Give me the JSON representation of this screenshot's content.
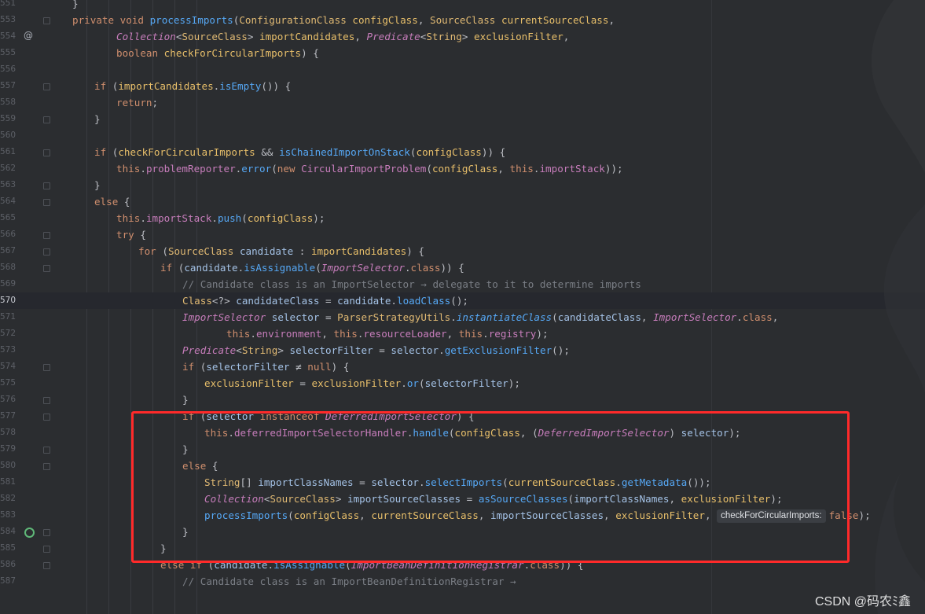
{
  "editor": {
    "lines": [
      {
        "n": "551",
        "html": "<span class='op'>}</span>",
        "indent": 1
      },
      {
        "n": "553",
        "html": "<span class='kw'>private void </span><span class='mth'>processImports</span><span class='op'>(</span><span class='cls'>ConfigurationClass</span><span class='op'> </span><span class='par'>configClass</span><span class='op'>, </span><span class='cls'>SourceClass</span><span class='op'> </span><span class='par'>currentSourceClass</span><span class='op'>,</span>",
        "indent": 1
      },
      {
        "n": "554",
        "html": "<span class='tyi'>Collection</span><span class='op'>&lt;</span><span class='cls'>SourceClass</span><span class='op'>&gt; </span><span class='par'>importCandidates</span><span class='op'>, </span><span class='tyi'>Predicate</span><span class='op'>&lt;</span><span class='cls'>String</span><span class='op'>&gt; </span><span class='par'>exclusionFilter</span><span class='op'>,</span>",
        "indent": 3
      },
      {
        "n": "555",
        "html": "<span class='kw'>boolean </span><span class='par'>checkForCircularImports</span><span class='op'>) {</span>",
        "indent": 3
      },
      {
        "n": "556",
        "html": "",
        "indent": 0
      },
      {
        "n": "557",
        "html": "<span class='kw'>if </span><span class='op'>(</span><span class='par'>importCandidates</span><span class='op'>.</span><span class='mth'>isEmpty</span><span class='op'>()) {</span>",
        "indent": 2
      },
      {
        "n": "558",
        "html": "<span class='kw'>return</span><span class='op'>;</span>",
        "indent": 3
      },
      {
        "n": "559",
        "html": "<span class='op'>}</span>",
        "indent": 2
      },
      {
        "n": "560",
        "html": "",
        "indent": 0
      },
      {
        "n": "561",
        "html": "<span class='kw'>if </span><span class='op'>(</span><span class='par'>checkForCircularImports</span><span class='op'> &amp;&amp; </span><span class='mth'>isChainedImportOnStack</span><span class='op'>(</span><span class='par'>configClass</span><span class='op'>)) {</span>",
        "indent": 2
      },
      {
        "n": "562",
        "html": "<span class='kw'>this</span><span class='op'>.</span><span class='fld'>problemReporter</span><span class='op'>.</span><span class='mth'>error</span><span class='op'>(</span><span class='kw'>new </span><span class='ty'>CircularImportProblem</span><span class='op'>(</span><span class='par'>configClass</span><span class='op'>, </span><span class='kw'>this</span><span class='op'>.</span><span class='fld'>importStack</span><span class='op'>));</span>",
        "indent": 3
      },
      {
        "n": "563",
        "html": "<span class='op'>}</span>",
        "indent": 2
      },
      {
        "n": "564",
        "html": "<span class='kw'>else </span><span class='op'>{</span>",
        "indent": 2
      },
      {
        "n": "565",
        "html": "<span class='kw'>this</span><span class='op'>.</span><span class='fld'>importStack</span><span class='op'>.</span><span class='mth'>push</span><span class='op'>(</span><span class='par'>configClass</span><span class='op'>);</span>",
        "indent": 3
      },
      {
        "n": "566",
        "html": "<span class='kw'>try </span><span class='op'>{</span>",
        "indent": 3
      },
      {
        "n": "567",
        "html": "<span class='kw'>for </span><span class='op'>(</span><span class='cls'>SourceClass</span><span class='op'> </span><span class='lv'>candidate</span><span class='op'> : </span><span class='par'>importCandidates</span><span class='op'>) {</span>",
        "indent": 4
      },
      {
        "n": "568",
        "html": "<span class='kw'>if </span><span class='op'>(</span><span class='lv'>candidate</span><span class='op'>.</span><span class='mth'>isAssignable</span><span class='op'>(</span><span class='tyi'>ImportSelector</span><span class='op'>.</span><span class='kw'>class</span><span class='op'>)) {</span>",
        "indent": 5
      },
      {
        "n": "569",
        "html": "<span class='cmt'>// Candidate class is an ImportSelector → delegate to it to determine imports</span>",
        "indent": 6
      },
      {
        "n": "570",
        "html": "<span class='cls'>Class</span><span class='op'>&lt;?&gt; </span><span class='lv'>candidateClass</span><span class='op'> = </span><span class='lv'>candidate</span><span class='op'>.</span><span class='mth'>loadClass</span><span class='op'>();</span>",
        "indent": 6,
        "current": true
      },
      {
        "n": "571",
        "html": "<span class='tyi'>ImportSelector</span><span class='op'> </span><span class='lv'>selector</span><span class='op'> = </span><span class='cls'>ParserStrategyUtils</span><span class='op'>.</span><span class='sm'>instantiateClass</span><span class='op'>(</span><span class='lv'>candidateClass</span><span class='op'>, </span><span class='tyi'>ImportSelector</span><span class='op'>.</span><span class='kw'>class</span><span class='op'>,</span>",
        "indent": 6
      },
      {
        "n": "572",
        "html": "<span class='kw'>this</span><span class='op'>.</span><span class='fld'>environment</span><span class='op'>, </span><span class='kw'>this</span><span class='op'>.</span><span class='fld'>resourceLoader</span><span class='op'>, </span><span class='kw'>this</span><span class='op'>.</span><span class='fld'>registry</span><span class='op'>);</span>",
        "indent": 8
      },
      {
        "n": "573",
        "html": "<span class='tyi'>Predicate</span><span class='op'>&lt;</span><span class='cls'>String</span><span class='op'>&gt; </span><span class='lv'>selectorFilter</span><span class='op'> = </span><span class='lv'>selector</span><span class='op'>.</span><span class='mth'>getExclusionFilter</span><span class='op'>();</span>",
        "indent": 6
      },
      {
        "n": "574",
        "html": "<span class='kw'>if </span><span class='op'>(</span><span class='lv'>selectorFilter</span><span class='op'> ≠ </span><span class='kw'>null</span><span class='op'>) {</span>",
        "indent": 6
      },
      {
        "n": "575",
        "html": "<span class='par'>exclusionFilter</span><span class='op'> = </span><span class='par'>exclusionFilter</span><span class='op'>.</span><span class='mth'>or</span><span class='op'>(</span><span class='lv'>selectorFilter</span><span class='op'>);</span>",
        "indent": 7
      },
      {
        "n": "576",
        "html": "<span class='op'>}</span>",
        "indent": 6
      },
      {
        "n": "577",
        "html": "<span class='kw'>if </span><span class='op'>(</span><span class='lv'>selector</span><span class='op'> </span><span class='kw'>instanceof </span><span class='tyi'>DeferredImportSelector</span><span class='op'>) {</span>",
        "indent": 6
      },
      {
        "n": "578",
        "html": "<span class='kw'>this</span><span class='op'>.</span><span class='fld'>deferredImportSelectorHandler</span><span class='op'>.</span><span class='mth'>handle</span><span class='op'>(</span><span class='par'>configClass</span><span class='op'>, (</span><span class='tyi'>DeferredImportSelector</span><span class='op'>) </span><span class='lv'>selector</span><span class='op'>);</span>",
        "indent": 7
      },
      {
        "n": "579",
        "html": "<span class='op'>}</span>",
        "indent": 6
      },
      {
        "n": "580",
        "html": "<span class='kw'>else </span><span class='op'>{</span>",
        "indent": 6
      },
      {
        "n": "581",
        "html": "<span class='cls'>String</span><span class='op'>[] </span><span class='lv'>importClassNames</span><span class='op'> = </span><span class='lv'>selector</span><span class='op'>.</span><span class='mth'>selectImports</span><span class='op'>(</span><span class='par'>currentSourceClass</span><span class='op'>.</span><span class='mth'>getMetadata</span><span class='op'>());</span>",
        "indent": 7
      },
      {
        "n": "582",
        "html": "<span class='tyi'>Collection</span><span class='op'>&lt;</span><span class='cls'>SourceClass</span><span class='op'>&gt; </span><span class='lv'>importSourceClasses</span><span class='op'> = </span><span class='mth'>asSourceClasses</span><span class='op'>(</span><span class='lv'>importClassNames</span><span class='op'>, </span><span class='par'>exclusionFilter</span><span class='op'>);</span>",
        "indent": 7
      },
      {
        "n": "583",
        "html": "<span class='mth'>processImports</span><span class='op'>(</span><span class='par'>configClass</span><span class='op'>, </span><span class='par'>currentSourceClass</span><span class='op'>, </span><span class='lv'>importSourceClasses</span><span class='op'>, </span><span class='par'>exclusionFilter</span><span class='op'>, </span><span class='hint'>checkForCircularImports:</span><span class='kw'>false</span><span class='op'>);</span>",
        "indent": 7
      },
      {
        "n": "584",
        "html": "<span class='op'>}</span>",
        "indent": 6
      },
      {
        "n": "585",
        "html": "<span class='op'>}</span>",
        "indent": 5
      },
      {
        "n": "586",
        "html": "<span class='kw'>else if </span><span class='op'>(</span><span class='lv'>candidate</span><span class='op'>.</span><span class='mth'>isAssignable</span><span class='op'>(</span><span class='tyi'>ImportBeanDefinitionRegistrar</span><span class='op'>.</span><span class='kw'>class</span><span class='op'>)) {</span>",
        "indent": 5
      },
      {
        "n": "587",
        "html": "<span class='cmt'>// Candidate class is an ImportBeanDefinitionRegistrar →</span>",
        "indent": 6
      }
    ]
  },
  "gutter": {
    "override_icon": "@",
    "implements_icon": "gutter-implements-icon"
  },
  "watermark": "CSDN @码农ﾐ鑫",
  "colors": {
    "highlight_box": "#ff2a2a",
    "background": "#2b2d30"
  }
}
